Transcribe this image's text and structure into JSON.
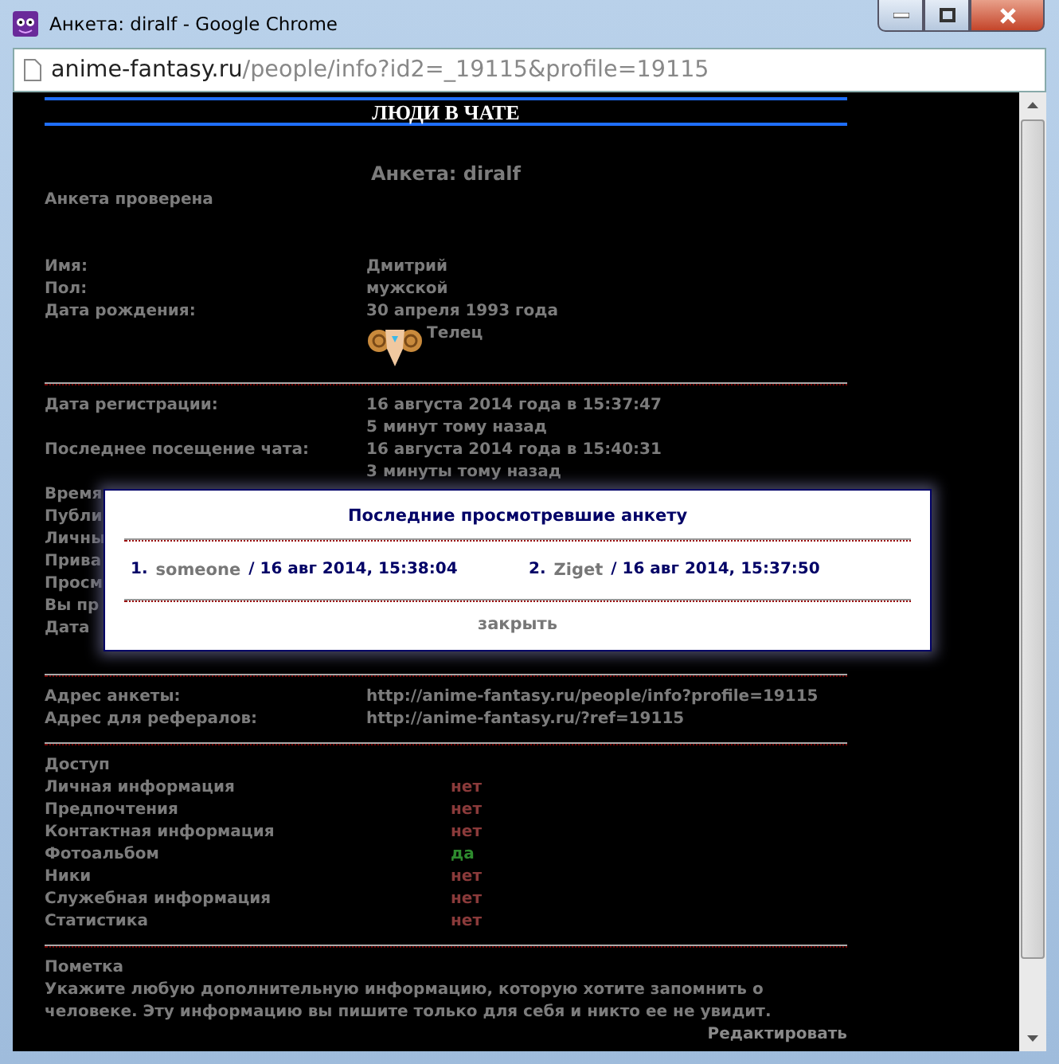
{
  "window": {
    "title": "Анкета: diralf - Google Chrome",
    "address": {
      "host": "anime-fantasy.ru",
      "path": "/people/info?id2=_19115&profile=19115"
    }
  },
  "page": {
    "banner": "ЛЮДИ В ЧАТЕ",
    "heading": "Анкета: diralf",
    "status": "Анкета проверена",
    "personal": [
      {
        "label": "Имя:",
        "value": "Дмитрий"
      },
      {
        "label": "Пол:",
        "value": "мужской"
      },
      {
        "label": "Дата рождения:",
        "value": "30 апреля 1993 года"
      }
    ],
    "zodiac": "Телец",
    "activity": [
      {
        "label": "Дата регистрации:",
        "values": [
          "16 августа 2014 года в 15:37:47",
          "5 минут тому назад"
        ]
      },
      {
        "label": "Последнее посещение чата:",
        "values": [
          "16 августа 2014 года в 15:40:31",
          "3 минуты тому назад"
        ]
      }
    ],
    "covered_labels": [
      "Время",
      "Публи",
      "Личны",
      "Прива",
      "Просм",
      "Вы пр",
      "Дата"
    ],
    "links": [
      {
        "label": "Адрес анкеты:",
        "url": "http://anime-fantasy.ru/people/info?profile=19115"
      },
      {
        "label": "Адрес для рефералов:",
        "url": "http://anime-fantasy.ru/?ref=19115"
      }
    ],
    "access": {
      "title": "Доступ",
      "items": [
        {
          "label": "Личная информация",
          "value": "нет",
          "granted": false
        },
        {
          "label": "Предпочтения",
          "value": "нет",
          "granted": false
        },
        {
          "label": "Контактная информация",
          "value": "нет",
          "granted": false
        },
        {
          "label": "Фотоальбом",
          "value": "да",
          "granted": true
        },
        {
          "label": "Ники",
          "value": "нет",
          "granted": false
        },
        {
          "label": "Служебная информация",
          "value": "нет",
          "granted": false
        },
        {
          "label": "Статистика",
          "value": "нет",
          "granted": false
        }
      ]
    },
    "note": {
      "title": "Пометка",
      "text": "Укажите любую дополнительную информацию, которую хотите запомнить о человеке. Эту информацию вы пишите только для себя и никто ее не увидит.",
      "edit": "Редактировать"
    }
  },
  "popup": {
    "title": "Последние просмотревшие анкету",
    "viewers": [
      {
        "number": "1.",
        "name": "someone",
        "time": "/ 16 авг 2014, 15:38:04"
      },
      {
        "number": "2.",
        "name": "Ziget",
        "time": "/ 16 авг 2014, 15:37:50"
      }
    ],
    "close": "закрыть"
  }
}
